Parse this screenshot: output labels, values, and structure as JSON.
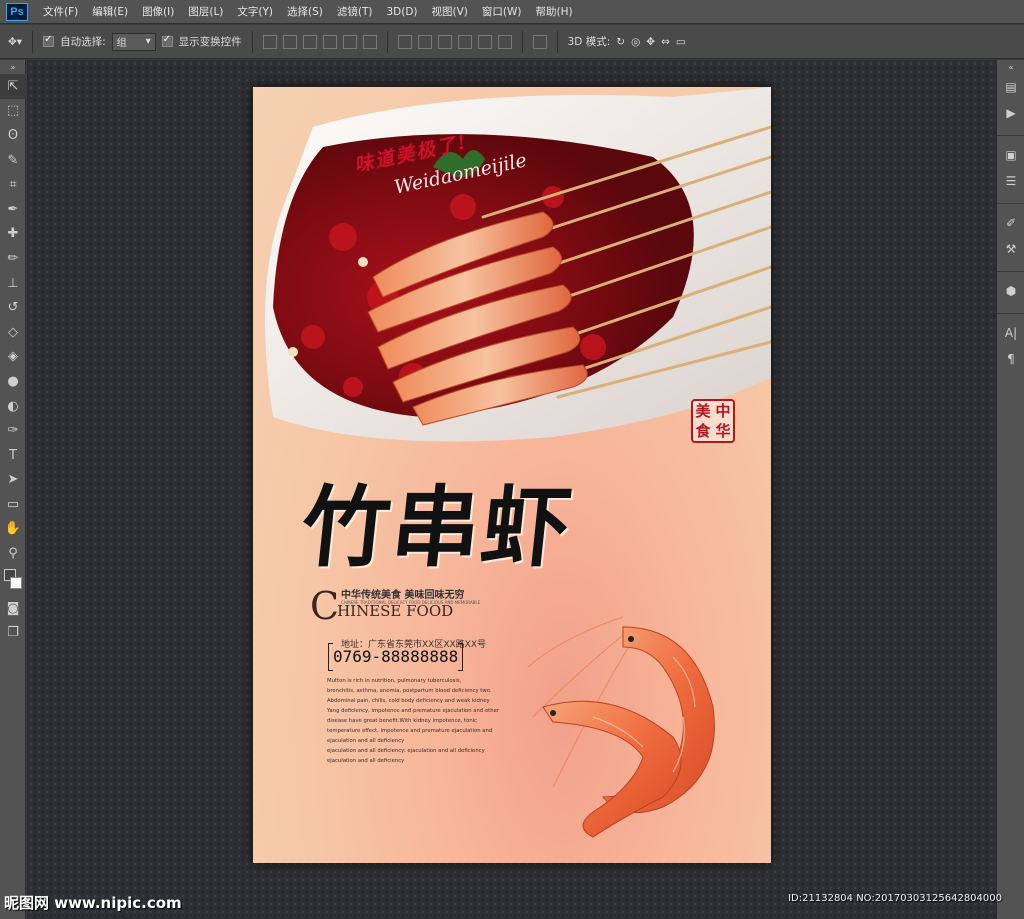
{
  "app": {
    "logo": "Ps",
    "menu": [
      "文件(F)",
      "编辑(E)",
      "图像(I)",
      "图层(L)",
      "文字(Y)",
      "选择(S)",
      "滤镜(T)",
      "3D(D)",
      "视图(V)",
      "窗口(W)",
      "帮助(H)"
    ]
  },
  "options": {
    "auto_select_label": "自动选择:",
    "auto_select_value": "组",
    "show_transform_label": "显示变换控件",
    "mode3d_label": "3D 模式:"
  },
  "tools": [
    "move-icon",
    "marquee-icon",
    "lasso-icon",
    "quick-select-icon",
    "crop-icon",
    "eyedropper-icon",
    "healing-icon",
    "brush-icon",
    "stamp-icon",
    "history-brush-icon",
    "eraser-icon",
    "bucket-icon",
    "blur-icon",
    "dodge-icon",
    "pen-icon",
    "type-icon",
    "path-select-icon",
    "shape-icon",
    "hand-icon",
    "zoom-icon"
  ],
  "poster": {
    "tagline": "味道美极了!",
    "tagline_en": "Weidaomeijile",
    "seal": [
      "美",
      "中",
      "食",
      "华"
    ],
    "title": "竹串虾",
    "subtitle_cn": "中华传统美食  美味回味无穷",
    "subtitle_small": "CHINESE TRADITIONAL DELICACY FOOD DELICIOUS AND MEMORABLE",
    "chinese_food_initial": "C",
    "chinese_food_rest": "HINESE FOOD",
    "address": "地址：广东省东莞市XX区XX路XX号",
    "phone": "0769-88888888",
    "body_lines": [
      "Mutton is rich in nutrition, pulmonary tuberculosis,",
      "bronchitis, asthma, anemia, postpartum blood deficiency two.",
      "Abdominal pain, chills, cold body deficiency and weak kidney",
      "Yang deficiency, impotence and premature ejaculation and other",
      "disease have great benefit.With kidney impotence, tonic",
      "temperature effect, impotence and premature ejaculation and",
      "ejaculation and all deficiency",
      "ejaculation and all deficiency: ejaculation and all deficiency",
      "ejaculation and all deficiency"
    ]
  },
  "watermark": {
    "left": "昵图网 www.nipic.com",
    "right": "ID:21132804 NO:20170303125642804000"
  },
  "colors": {
    "ui_dark": "#535353",
    "accent_red": "#d0102a",
    "poster_bg": "#f6c7a6"
  }
}
